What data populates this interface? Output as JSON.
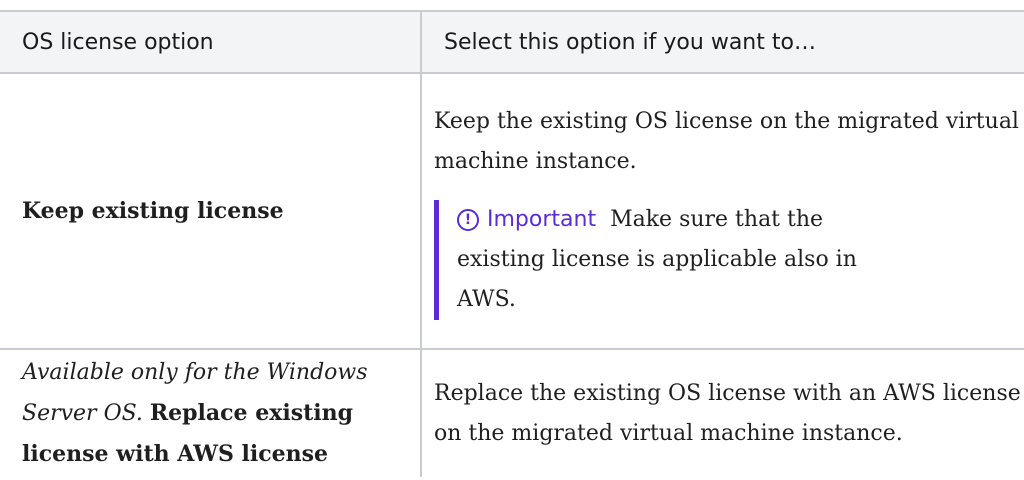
{
  "table": {
    "headers": [
      "OS license option",
      "Select this option if you want to…"
    ],
    "row1": {
      "option": "Keep existing license",
      "description": "Keep the existing OS license on the migrated virtual machine instance.",
      "callout": {
        "icon": "exclamation-circle-icon",
        "label": "Important",
        "text": "Make sure that the existing license is applicable also in AWS."
      }
    },
    "row2": {
      "option_prefix": "Available only for the Windows Server OS.",
      "option_bold": "Replace existing license with AWS license",
      "description": "Replace the existing OS license with an AWS license on the migrated virtual machine instance."
    }
  },
  "colors": {
    "header_bg": "#f3f4f6",
    "border": "#c9ccd1",
    "accent": "#5b2bd6"
  }
}
